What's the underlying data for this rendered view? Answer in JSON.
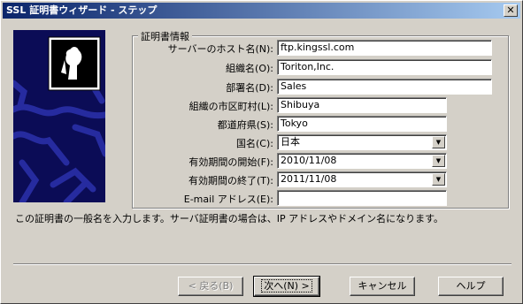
{
  "window": {
    "title": "SSL 証明書ウィザード - ステップ",
    "close_glyph": "✕"
  },
  "group": {
    "title": "証明書情報"
  },
  "form": {
    "fields": [
      {
        "label": "サーバーのホスト名(N):",
        "value": "ftp.kingssl.com",
        "type": "text"
      },
      {
        "label": "組織名(O):",
        "value": "Toriton,Inc.",
        "type": "text"
      },
      {
        "label": "部署名(D):",
        "value": "Sales",
        "type": "text"
      },
      {
        "label": "組織の市区町村(L):",
        "value": "Shibuya",
        "type": "text"
      },
      {
        "label": "都道府県(S):",
        "value": "Tokyo",
        "type": "text"
      },
      {
        "label": "国名(C):",
        "value": "日本",
        "type": "select"
      },
      {
        "label": "有効期間の開始(F):",
        "value": "2010/11/08",
        "type": "select"
      },
      {
        "label": "有効期間の終了(T):",
        "value": "2011/11/08",
        "type": "select"
      },
      {
        "label": "E-mail アドレス(E):",
        "value": "",
        "type": "text"
      }
    ]
  },
  "hint": "この証明書の一般名を入力します。サーバ証明書の場合は、IP アドレスやドメイン名になります。",
  "buttons": {
    "back": "< 戻る(B)",
    "next": "次へ(N) >",
    "cancel": "キャンセル",
    "help": "ヘルプ"
  },
  "colors": {
    "titlebar_start": "#0a246a",
    "titlebar_end": "#a6caf0",
    "dialog_face": "#d4d0c8",
    "side_image_bg": "#0b0c56"
  },
  "icons": {
    "side_image": "certificate-person-icon",
    "combo_arrow": "chevron-down-icon"
  }
}
